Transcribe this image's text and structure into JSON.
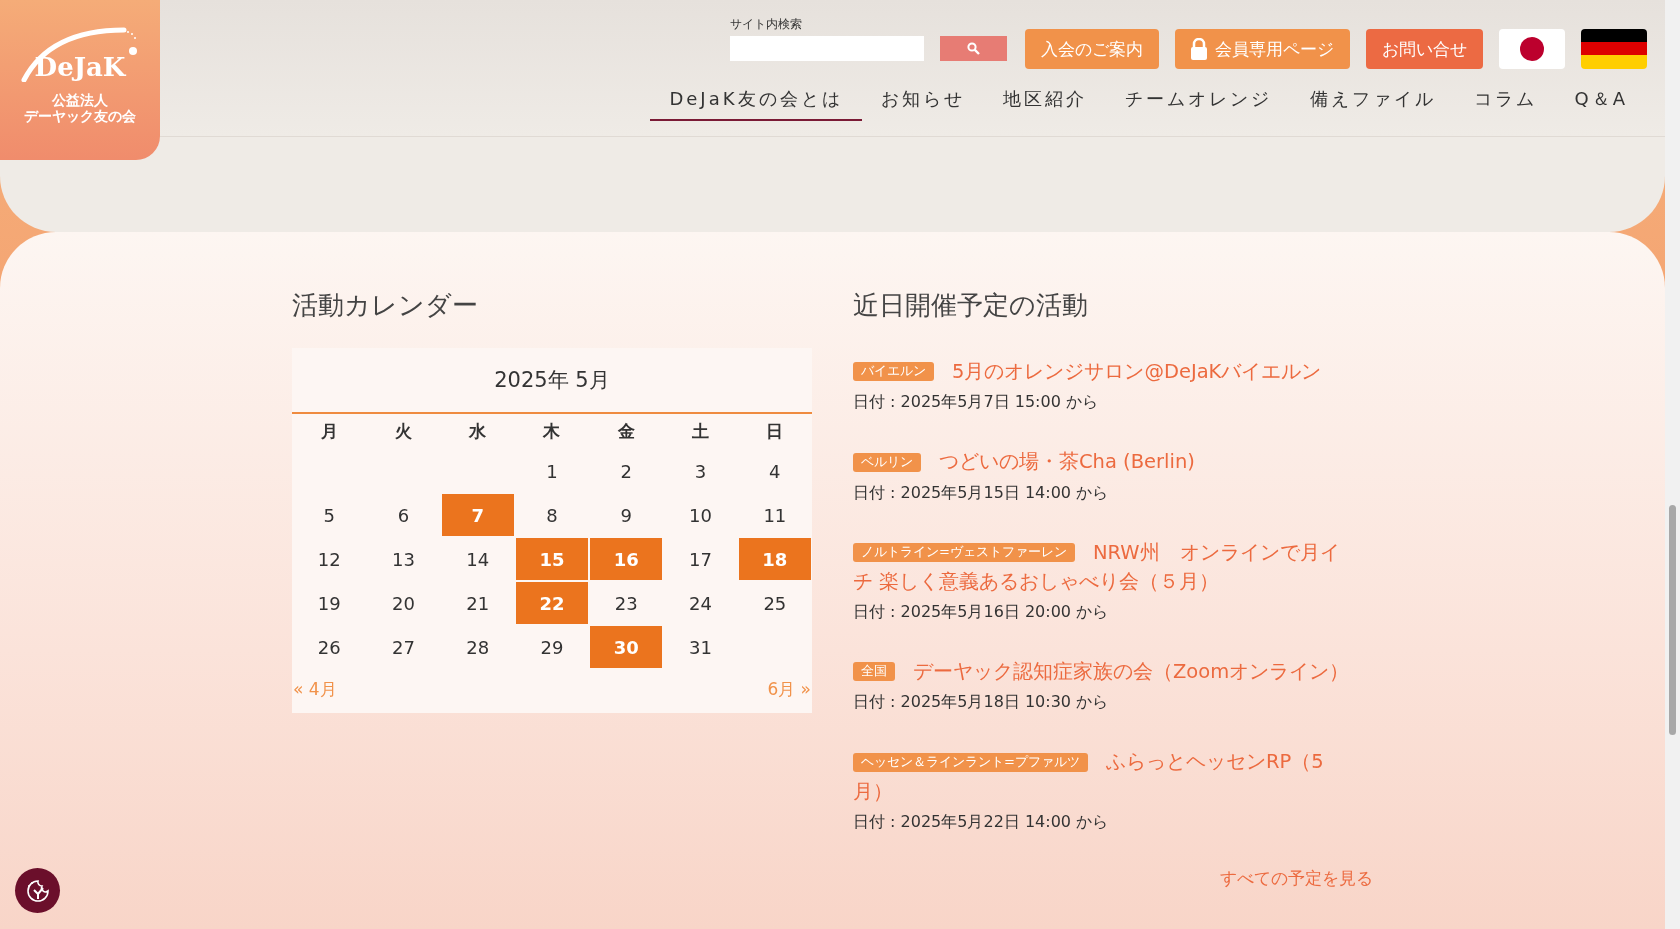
{
  "logo": {
    "wordmark": "DeJaK",
    "line1": "公益法人",
    "line2": "デーヤック友の会"
  },
  "search": {
    "label": "サイト内検索"
  },
  "header_buttons": [
    {
      "label": "入会のご案内",
      "kind": "plain"
    },
    {
      "label": "会員専用ページ",
      "kind": "lock"
    },
    {
      "label": "お問い合せ",
      "kind": "contact"
    }
  ],
  "languages": [
    {
      "kind": "japan"
    },
    {
      "kind": "germany"
    }
  ],
  "nav": [
    {
      "label": "DeJaK友の会とは",
      "selected": true
    },
    {
      "label": "お知らせ",
      "selected": false
    },
    {
      "label": "地区紹介",
      "selected": false
    },
    {
      "label": "チームオレンジ",
      "selected": false
    },
    {
      "label": "備えファイル",
      "selected": false
    },
    {
      "label": "コラム",
      "selected": false
    },
    {
      "label": "Q＆A",
      "selected": false
    }
  ],
  "calendar": {
    "heading": "活動カレンダー",
    "month": "2025年 5月",
    "weekdays": [
      "月",
      "火",
      "水",
      "木",
      "金",
      "土",
      "日"
    ],
    "weeks": [
      [
        {
          "kind": "blank"
        },
        {
          "kind": "blank"
        },
        {
          "kind": "blank"
        },
        {
          "kind": "day",
          "day": "1",
          "event": false
        },
        {
          "kind": "day",
          "day": "2",
          "event": false
        },
        {
          "kind": "day",
          "day": "3",
          "event": false
        },
        {
          "kind": "day",
          "day": "4",
          "event": false
        }
      ],
      [
        {
          "kind": "day",
          "day": "5",
          "event": false
        },
        {
          "kind": "day",
          "day": "6",
          "event": false
        },
        {
          "kind": "day",
          "day": "7",
          "event": true
        },
        {
          "kind": "day",
          "day": "8",
          "event": false
        },
        {
          "kind": "day",
          "day": "9",
          "event": false
        },
        {
          "kind": "day",
          "day": "10",
          "event": false
        },
        {
          "kind": "day",
          "day": "11",
          "event": false
        }
      ],
      [
        {
          "kind": "day",
          "day": "12",
          "event": false
        },
        {
          "kind": "day",
          "day": "13",
          "event": false
        },
        {
          "kind": "day",
          "day": "14",
          "event": false
        },
        {
          "kind": "day",
          "day": "15",
          "event": true
        },
        {
          "kind": "day",
          "day": "16",
          "event": true
        },
        {
          "kind": "day",
          "day": "17",
          "event": false
        },
        {
          "kind": "day",
          "day": "18",
          "event": true
        }
      ],
      [
        {
          "kind": "day",
          "day": "19",
          "event": false
        },
        {
          "kind": "day",
          "day": "20",
          "event": false
        },
        {
          "kind": "day",
          "day": "21",
          "event": false
        },
        {
          "kind": "day",
          "day": "22",
          "event": true
        },
        {
          "kind": "day",
          "day": "23",
          "event": false
        },
        {
          "kind": "day",
          "day": "24",
          "event": false
        },
        {
          "kind": "day",
          "day": "25",
          "event": false
        }
      ],
      [
        {
          "kind": "day",
          "day": "26",
          "event": false
        },
        {
          "kind": "day",
          "day": "27",
          "event": false
        },
        {
          "kind": "day",
          "day": "28",
          "event": false
        },
        {
          "kind": "day",
          "day": "29",
          "event": false
        },
        {
          "kind": "day",
          "day": "30",
          "event": true
        },
        {
          "kind": "day",
          "day": "31",
          "event": false
        },
        {
          "kind": "blank"
        }
      ]
    ],
    "prev": "« 4月",
    "next": "6月 »"
  },
  "upcoming": {
    "heading": "近日開催予定の活動",
    "events": [
      {
        "tag": "バイエルン",
        "title_lines": [
          "5月のオレンジサロン@DeJaKバイエルン"
        ],
        "date": "日付 : 2025年5月7日 15:00 から"
      },
      {
        "tag": "ベルリン",
        "title_lines": [
          "つどいの場・茶Cha (Berlin)"
        ],
        "date": "日付 : 2025年5月15日 14:00 から"
      },
      {
        "tag": "ノルトライン=ヴェストファーレン",
        "title_lines": [
          "NRW州　オンラインで月イ",
          "チ 楽しく意義あるおしゃべり会（５月）"
        ],
        "date": "日付 : 2025年5月16日 20:00 から"
      },
      {
        "tag": "全国",
        "title_lines": [
          "デーヤック認知症家族の会（Zoomオンライン）"
        ],
        "date": "日付 : 2025年5月18日 10:30 から"
      },
      {
        "tag": "ヘッセン＆ラインラント=プファルツ",
        "title_lines": [
          "ふらっとヘッセンRP（5",
          "月）"
        ],
        "date": "日付 : 2025年5月22日 14:00 から"
      }
    ],
    "all_link": "すべての予定を見る"
  }
}
